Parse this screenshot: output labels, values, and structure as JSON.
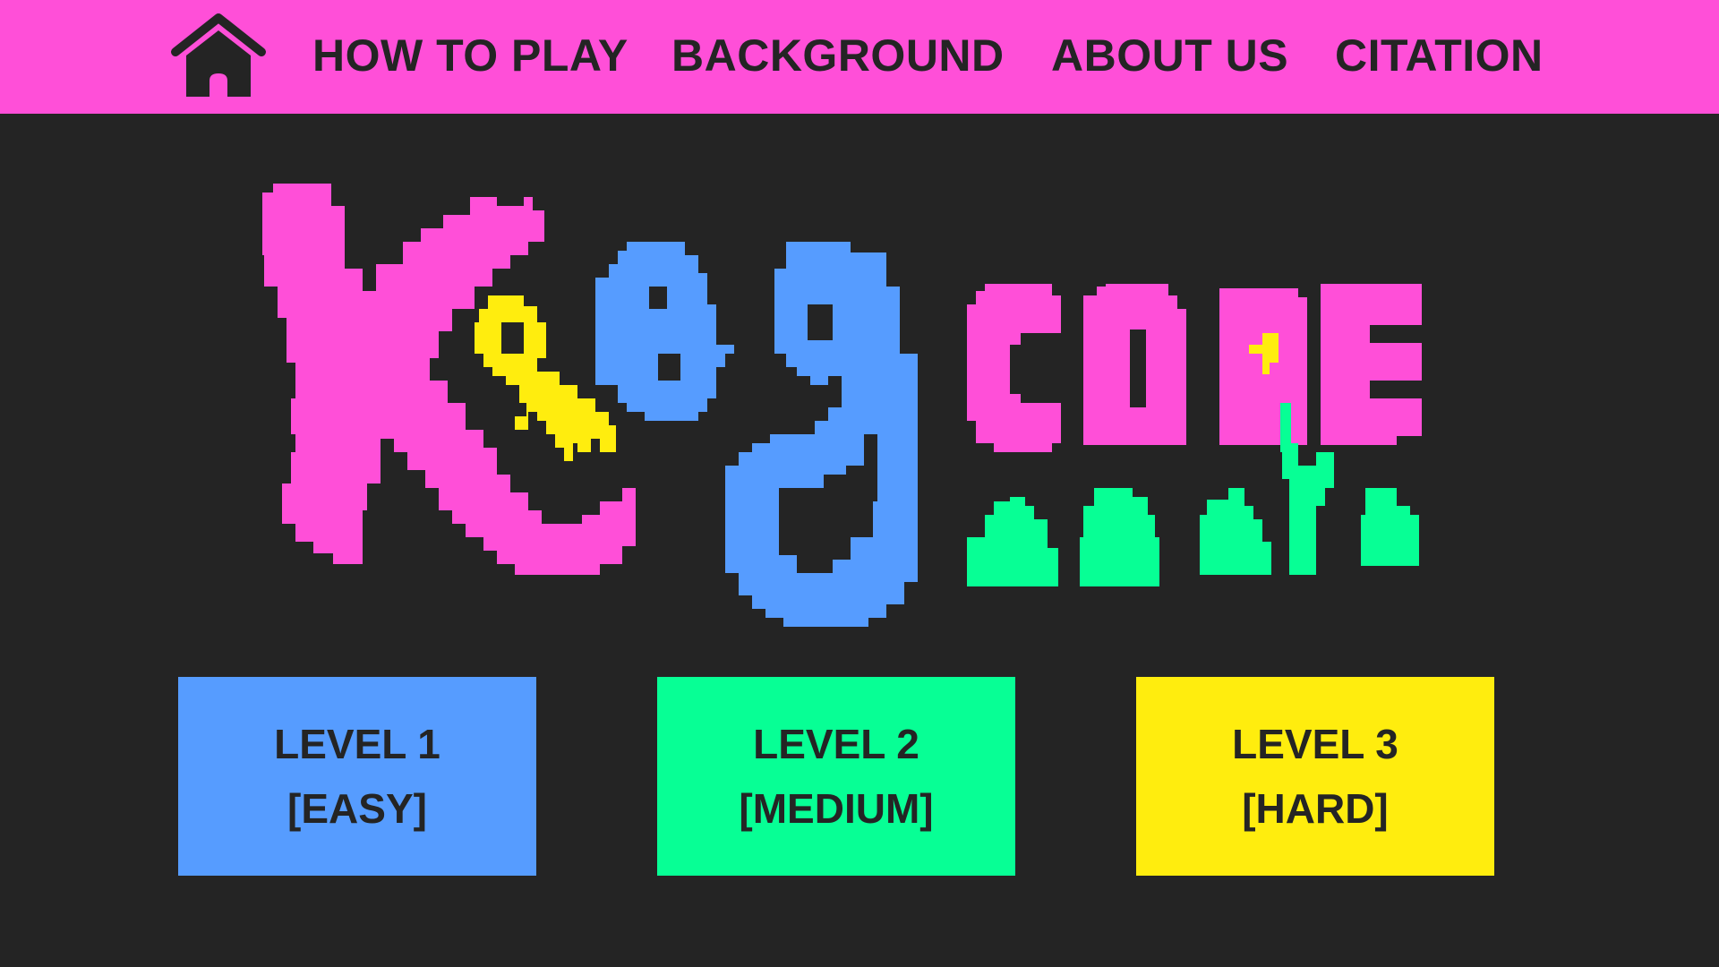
{
  "nav": {
    "home_icon": "house-icon",
    "items": [
      {
        "label": "HOW TO PLAY"
      },
      {
        "label": "BACKGROUND"
      },
      {
        "label": "ABOUT US"
      },
      {
        "label": "CITATION"
      }
    ]
  },
  "logo": {
    "wordmark": "Key code",
    "key_icon": "key-icon",
    "flower_icon": "tulip-icon"
  },
  "levels": [
    {
      "title": "LEVEL 1",
      "difficulty": "[EASY]",
      "color": "#569cff"
    },
    {
      "title": "LEVEL 2",
      "difficulty": "[MEDIUM]",
      "color": "#07ff95"
    },
    {
      "title": "LEVEL 3",
      "difficulty": "[HARD]",
      "color": "#ffed0e"
    }
  ],
  "colors": {
    "background": "#242424",
    "navbar": "#ff4fd8",
    "text": "#242424",
    "pink": "#ff4fd8",
    "blue": "#569cff",
    "green": "#07ff95",
    "yellow": "#ffed0e"
  }
}
